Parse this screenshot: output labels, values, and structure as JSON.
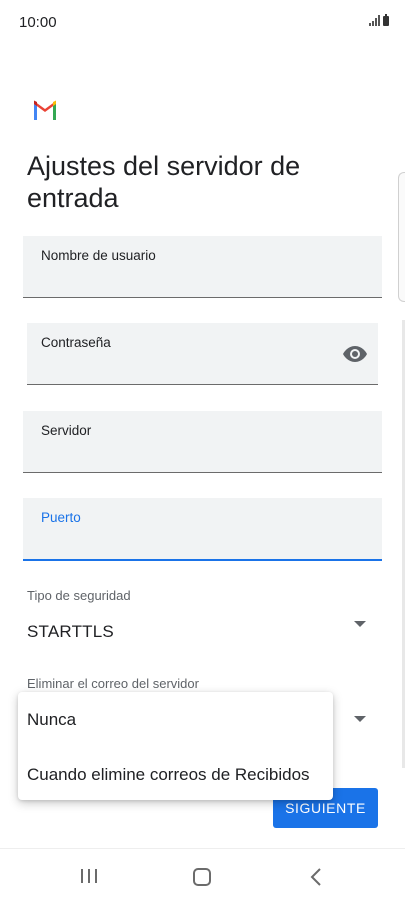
{
  "status_bar": {
    "time": "10:00"
  },
  "page": {
    "title": "Ajustes del servidor de entrada"
  },
  "fields": {
    "username": {
      "label": "Nombre de usuario",
      "value": ""
    },
    "password": {
      "label": "Contraseña",
      "value": ""
    },
    "server": {
      "label": "Servidor",
      "value": ""
    },
    "port": {
      "label": "Puerto",
      "value": ""
    }
  },
  "security": {
    "label": "Tipo de seguridad",
    "value": "STARTTLS"
  },
  "delete_from_server": {
    "label": "Eliminar el correo del servidor",
    "options": [
      "Nunca",
      "Cuando elimine correos de Recibidos"
    ]
  },
  "buttons": {
    "next": "SIGUIENTE"
  },
  "icons": {
    "logo": "gmail-logo",
    "password_toggle": "eye-icon",
    "dropdown": "dropdown-arrow-icon",
    "nav_recents": "recents-icon",
    "nav_home": "home-icon",
    "nav_back": "back-icon"
  },
  "colors": {
    "accent": "#1a73e8",
    "field_bg": "#f1f3f4"
  }
}
